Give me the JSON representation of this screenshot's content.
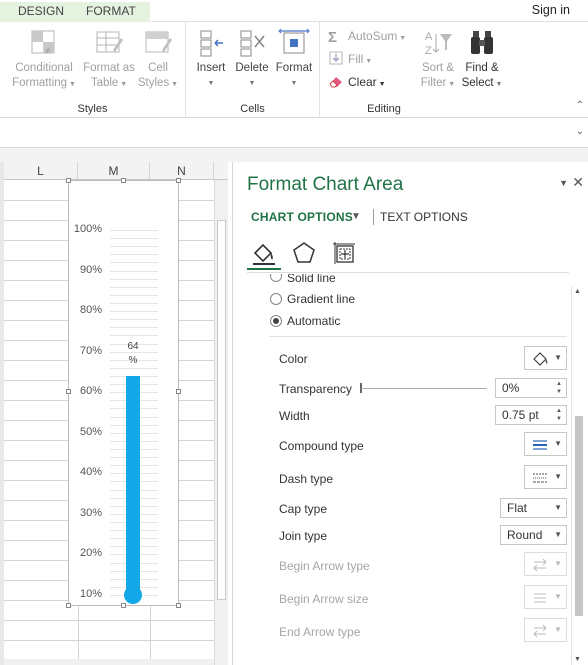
{
  "ribbon": {
    "tabs": [
      "DESIGN",
      "FORMAT"
    ],
    "sign_in": "Sign in",
    "groups": {
      "styles": {
        "label": "Styles",
        "buttons": [
          {
            "line1": "Conditional",
            "line2": "Formatting"
          },
          {
            "line1": "Format as",
            "line2": "Table"
          },
          {
            "line1": "Cell",
            "line2": "Styles"
          }
        ]
      },
      "cells": {
        "label": "Cells",
        "buttons": [
          "Insert",
          "Delete",
          "Format"
        ]
      },
      "editing": {
        "label": "Editing",
        "autosum": "AutoSum",
        "fill": "Fill",
        "clear": "Clear",
        "sort_filter": {
          "line1": "Sort &",
          "line2": "Filter"
        },
        "find_select": {
          "line1": "Find &",
          "line2": "Select"
        }
      }
    }
  },
  "sheet": {
    "columns": [
      "L",
      "M",
      "N"
    ]
  },
  "chart_data": {
    "type": "bar",
    "categories": [
      ""
    ],
    "values": [
      64
    ],
    "data_label": {
      "value": "64",
      "unit": "%"
    },
    "y_ticks": [
      "100%",
      "90%",
      "80%",
      "70%",
      "60%",
      "50%",
      "40%",
      "30%",
      "20%",
      "10%"
    ],
    "ylim": [
      10,
      100
    ],
    "color": "#12a8e8",
    "grid": true
  },
  "pane": {
    "title": "Format Chart Area",
    "tab_chart_options": "CHART OPTIONS",
    "tab_text_options": "TEXT OPTIONS",
    "icons": [
      "fill-line-icon",
      "effects-icon",
      "size-properties-icon"
    ],
    "line_options": {
      "solid_line": "Solid line",
      "gradient_line": "Gradient line",
      "automatic": "Automatic",
      "selected": "Automatic"
    },
    "rows": {
      "color": "Color",
      "transparency": "Transparency",
      "transparency_value": "0%",
      "width": "Width",
      "width_value": "0.75 pt",
      "compound_type": "Compound type",
      "dash_type": "Dash type",
      "cap_type": "Cap type",
      "cap_type_value": "Flat",
      "join_type": "Join type",
      "join_type_value": "Round",
      "begin_arrow_type": "Begin Arrow type",
      "begin_arrow_size": "Begin Arrow size",
      "end_arrow_type": "End Arrow type"
    }
  }
}
